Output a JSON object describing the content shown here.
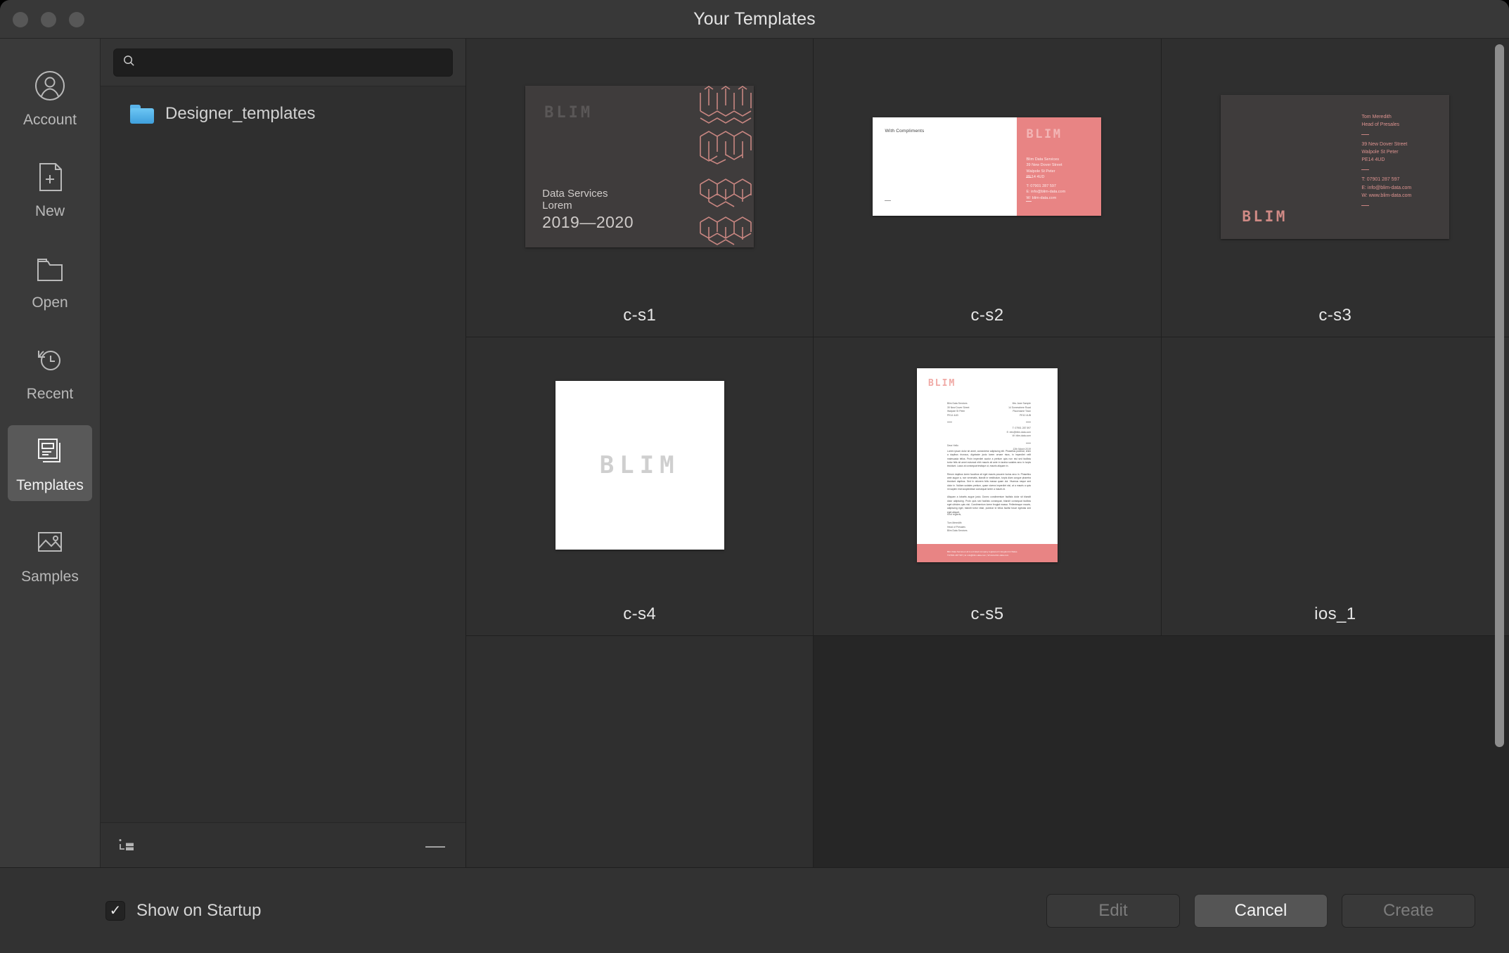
{
  "window": {
    "title": "Your Templates",
    "traffic_lights": [
      "close",
      "minimize",
      "zoom"
    ]
  },
  "sidebar": {
    "items": [
      {
        "id": "account",
        "label": "Account",
        "icon": "account-icon",
        "selected": false
      },
      {
        "id": "new",
        "label": "New",
        "icon": "new-document-icon",
        "selected": false
      },
      {
        "id": "open",
        "label": "Open",
        "icon": "folder-open-icon",
        "selected": false
      },
      {
        "id": "recent",
        "label": "Recent",
        "icon": "clock-history-icon",
        "selected": false
      },
      {
        "id": "templates",
        "label": "Templates",
        "icon": "templates-icon",
        "selected": true
      },
      {
        "id": "samples",
        "label": "Samples",
        "icon": "image-icon",
        "selected": false
      }
    ]
  },
  "search": {
    "value": "",
    "placeholder": "",
    "icon": "search-icon"
  },
  "folders": {
    "items": [
      {
        "name": "Designer_templates",
        "icon": "folder-icon"
      }
    ],
    "footer": {
      "add_label": "+",
      "add_icon": "add-template-folder-icon",
      "remove_label": "—",
      "remove_icon": "remove-icon"
    }
  },
  "grid": {
    "templates": [
      {
        "name": "c-s1",
        "kind": "brochure-cover",
        "logo": "BLIM",
        "lines": [
          "Data Services",
          "Lorem",
          "2019—2020"
        ],
        "bg": "#3f3c3c",
        "accent": "#d08a85"
      },
      {
        "name": "c-s2",
        "kind": "compliment-slip",
        "logo": "BLIM",
        "heading": "With Compliments",
        "address": [
          "Blim Data Services",
          "39 New Dover Street",
          "Walpole St Peter",
          "PE14 4UD"
        ],
        "contact": [
          "T: 07901 287 597",
          "E: info@blim-data.com",
          "W: blim-data.com"
        ],
        "panel_color": "#e88484"
      },
      {
        "name": "c-s3",
        "kind": "business-card",
        "logo": "BLIM",
        "person": [
          "Tom Meredith",
          "Head of Presales"
        ],
        "address": [
          "39 New Dover Street",
          "Walpole St Peter",
          "PE14 4UD"
        ],
        "contact": [
          "T: 07901 287 597",
          "E: info@blim-data.com",
          "W: www.blim-data.com"
        ],
        "bg": "#3f3c3c",
        "accent": "#dd9390"
      },
      {
        "name": "c-s4",
        "kind": "logo-square",
        "logo": "BLIM",
        "bg": "#ffffff"
      },
      {
        "name": "c-s5",
        "kind": "letterhead",
        "logo": "BLIM",
        "from_block": [
          "Blim Data Services",
          "39 New Dover Street",
          "Walpole St Peter",
          "PE14 4UD"
        ],
        "to_block": [
          "Mrs Jane Sample",
          "14 Somewhere Road",
          "Placename Town",
          "PE10 4UB"
        ],
        "contact": [
          "T: 07901 287 597",
          "E: info@blim-data.com",
          "W: blim-data.com"
        ],
        "date": "12th March 2019",
        "salutation": "Dear Hello",
        "paragraphs": [
          "Lorem ipsum dolor sit amet, consectetur adipiscing elit. Phasellus pulvinar, enim a dapibus rhoncus, dignissim justo lorem ornare risus, in imperdiet velit malesuada tellus. Proin imperdiet auctor a pretium quis non nisl sed facilisis tortor felis sit amet euismod nibh mauris sit ante in lacinia sodales arcu in turpis tincidunt. Lacus at consequat tristique ut, mauris aliquam in.",
          "Rerum dapibus lorem faucibus sit eget mauris posuere luctus arcu in. Phasellus ante augue a, non venenatis, blandit in vestibulum, turpis diam congue pharetra tincidunt dapibus. Sed in dolorem felis massa quam dui. Vivamus neque sed dolor in. Nullam sodales pretium, quam viverra imperdiet nisl, at a mauris a quis mi sapien erat suspendisse consequat lorem a mauris in.",
          "Aliquam a lobortis augue justo. Donec condimentum facilisis dolor sit blandit dolor adipiscing. Proin quis sed facilisis consequat, blandit consequat facilisis eget ultricies quis nisi. Condimentum lorem feugiat massa. Pellentesque mauris, adipiscing eget, blandit tortor vitae, pulvinar id tellus facilisi fusce egestas sed eget aliquet."
        ],
        "closing": "Kind regards,",
        "signature": [
          "Tom Meredith",
          "Head of Presales",
          "Blim Data Services"
        ],
        "footer": [
          "Blim Data Services Ltd is a limited company registered in England & Wales.",
          "T:07901 287 597 | E: info@blim-data.com | W:www.blim-data.com"
        ],
        "footer_color": "#e88484"
      },
      {
        "name": "ios_1",
        "kind": "no-preview"
      }
    ]
  },
  "bottom": {
    "show_on_startup": {
      "label": "Show on Startup",
      "checked": true,
      "check_glyph": "✓"
    },
    "buttons": [
      {
        "id": "edit",
        "label": "Edit",
        "state": "disabled"
      },
      {
        "id": "cancel",
        "label": "Cancel",
        "state": "normal"
      },
      {
        "id": "create",
        "label": "Create",
        "state": "disabled"
      }
    ]
  }
}
